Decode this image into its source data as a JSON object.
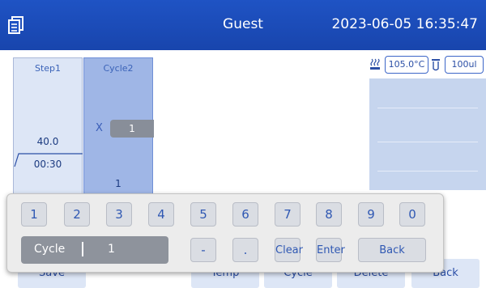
{
  "topbar": {
    "user": "Guest",
    "datetime": "2023-06-05 16:35:47"
  },
  "program": {
    "step1": {
      "label": "Step1",
      "temperature": "40.0",
      "time": "00:30"
    },
    "cycle2": {
      "label": "Cycle2",
      "x_label": "X",
      "count": "1",
      "step_number": "1"
    }
  },
  "side": {
    "lid_temperature": "105.0°C",
    "volume": "100ul"
  },
  "bottom_buttons": [
    "Save",
    "Temp",
    "Cycle",
    "Delete",
    "Back"
  ],
  "keypad": {
    "digits": [
      "1",
      "2",
      "3",
      "4",
      "5",
      "6",
      "7",
      "8",
      "9",
      "0"
    ],
    "field_label": "Cycle",
    "field_value": "1",
    "minus": "-",
    "dot": ".",
    "clear": "Clear",
    "enter": "Enter",
    "back": "Back"
  }
}
